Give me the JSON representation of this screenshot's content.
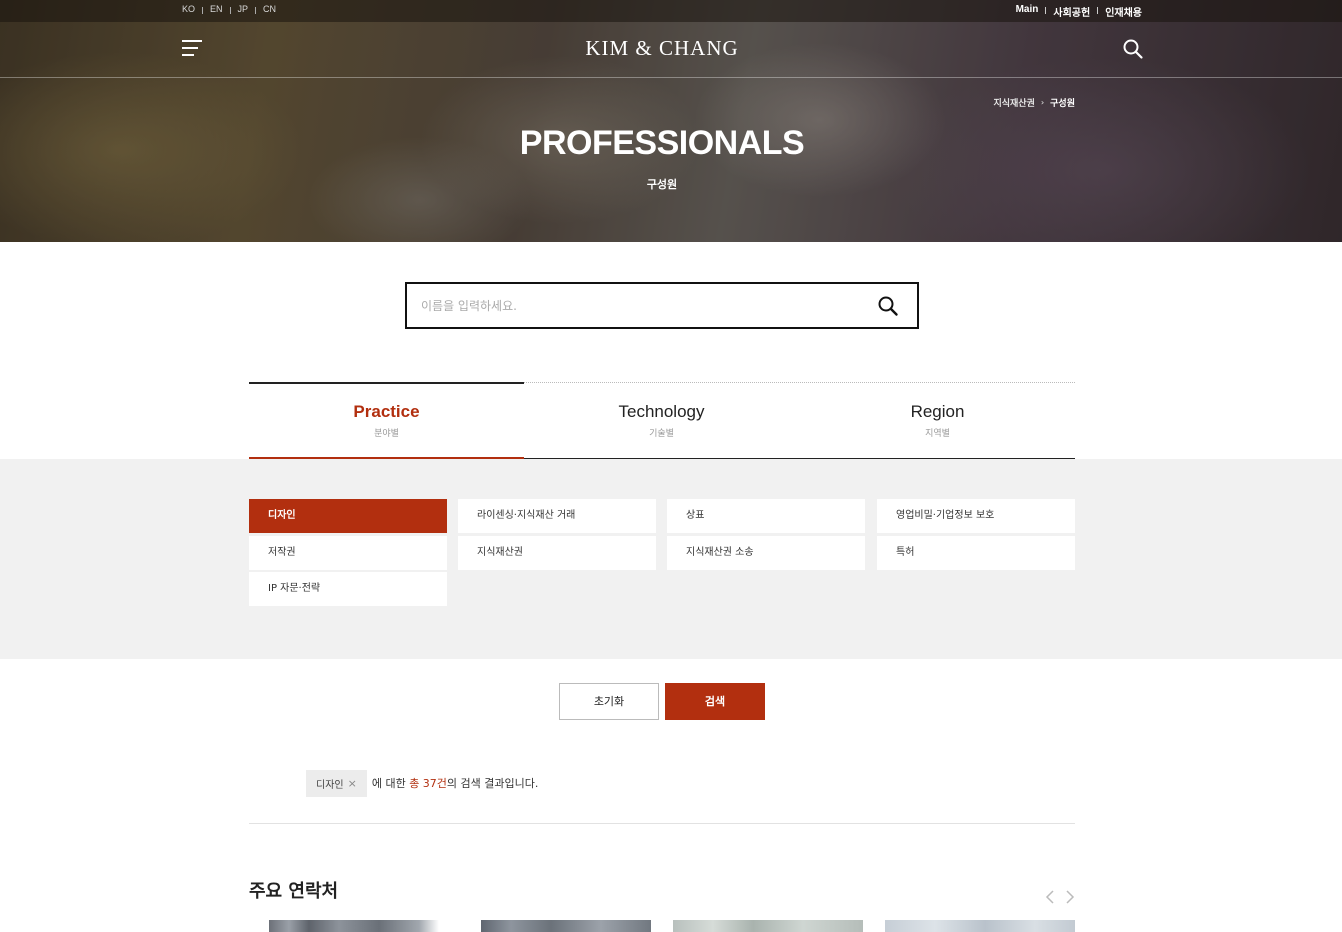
{
  "util": {
    "languages": [
      "KO",
      "EN",
      "JP",
      "CN"
    ],
    "links": [
      "Main",
      "사회공헌",
      "인재채용"
    ]
  },
  "header": {
    "logo": "KIM & CHANG"
  },
  "breadcrumb": {
    "parent": "지식재산권",
    "current": "구성원"
  },
  "hero": {
    "title": "PROFESSIONALS",
    "subtitle": "구성원"
  },
  "search": {
    "placeholder": "이름을 입력하세요.",
    "value": ""
  },
  "tabs": [
    {
      "label": "Practice",
      "sub": "분야별",
      "active": true
    },
    {
      "label": "Technology",
      "sub": "기술별",
      "active": false
    },
    {
      "label": "Region",
      "sub": "지역별",
      "active": false
    }
  ],
  "categories": [
    {
      "label": "디자인",
      "active": true
    },
    {
      "label": "라이센싱·지식재산 거래",
      "active": false
    },
    {
      "label": "상표",
      "active": false
    },
    {
      "label": "영업비밀·기업정보 보호",
      "active": false
    },
    {
      "label": "저작권",
      "active": false
    },
    {
      "label": "지식재산권",
      "active": false
    },
    {
      "label": "지식재산권 소송",
      "active": false
    },
    {
      "label": "특허",
      "active": false
    },
    {
      "label": "IP 자문·전략",
      "active": false
    }
  ],
  "actions": {
    "reset": "초기화",
    "search": "검색"
  },
  "result": {
    "chip": "디자인",
    "prefix": "에 대한",
    "count": "총 37건",
    "suffix": "의 검색 결과입니다."
  },
  "contacts": {
    "title": "주요 연락처"
  },
  "colors": {
    "accent": "#b22f0f"
  }
}
